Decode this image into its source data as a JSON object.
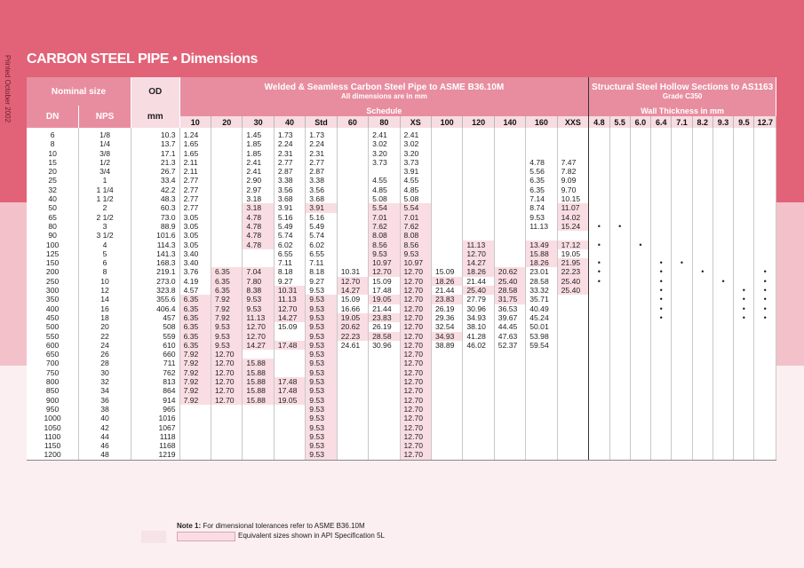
{
  "page": {
    "side_text": "Printed October 2002",
    "title": "CARBON STEEL PIPE • Dimensions"
  },
  "headers": {
    "nominal_size": "Nominal size",
    "od": "OD",
    "welded_title": "Welded & Seamless Carbon Steel Pipe to ASME B36.10M",
    "welded_sub": "All dimensions are in mm",
    "structural_title": "Structural Steel Hollow Sections to AS1163",
    "structural_sub": "Grade C350",
    "dn": "DN",
    "nps": "NPS",
    "mm": "mm",
    "schedule": "Schedule",
    "wall_thickness": "Wall Thickness in mm",
    "schedules": [
      "10",
      "20",
      "30",
      "40",
      "Std",
      "60",
      "80",
      "XS",
      "100",
      "120",
      "140",
      "160",
      "XXS"
    ],
    "wall": [
      "4.8",
      "5.5",
      "6.0",
      "6.4",
      "7.1",
      "8.2",
      "9.3",
      "9.5",
      "12.7"
    ]
  },
  "rows": [
    {
      "dn": "6",
      "nps": "1/8",
      "od": "10.3",
      "s": [
        "1.24",
        "",
        "1.45",
        "1.73",
        "1.73",
        "",
        "2.41",
        "2.41",
        "",
        "",
        "",
        "",
        ""
      ],
      "hl": [],
      "w": []
    },
    {
      "dn": "8",
      "nps": "1/4",
      "od": "13.7",
      "s": [
        "1.65",
        "",
        "1.85",
        "2.24",
        "2.24",
        "",
        "3.02",
        "3.02",
        "",
        "",
        "",
        "",
        ""
      ],
      "hl": [],
      "w": []
    },
    {
      "dn": "10",
      "nps": "3/8",
      "od": "17.1",
      "s": [
        "1.65",
        "",
        "1.85",
        "2.31",
        "2.31",
        "",
        "3.20",
        "3.20",
        "",
        "",
        "",
        "",
        ""
      ],
      "hl": [],
      "w": []
    },
    {
      "dn": "15",
      "nps": "1/2",
      "od": "21.3",
      "s": [
        "2.11",
        "",
        "2.41",
        "2.77",
        "2.77",
        "",
        "3.73",
        "3.73",
        "",
        "",
        "",
        "4.78",
        "7.47"
      ],
      "hl": [],
      "w": []
    },
    {
      "dn": "20",
      "nps": "3/4",
      "od": "26.7",
      "s": [
        "2.11",
        "",
        "2.41",
        "2.87",
        "2.87",
        "",
        "",
        "3.91",
        "",
        "",
        "",
        "5.56",
        "7.82"
      ],
      "hl": [],
      "w": []
    },
    {
      "dn": "25",
      "nps": "1",
      "od": "33.4",
      "s": [
        "2.77",
        "",
        "2.90",
        "3.38",
        "3.38",
        "",
        "4.55",
        "4.55",
        "",
        "",
        "",
        "6.35",
        "9.09"
      ],
      "hl": [],
      "w": []
    },
    {
      "dn": "32",
      "nps": "1 1/4",
      "od": "42.2",
      "s": [
        "2.77",
        "",
        "2.97",
        "3.56",
        "3.56",
        "",
        "4.85",
        "4.85",
        "",
        "",
        "",
        "6.35",
        "9.70"
      ],
      "hl": [],
      "w": []
    },
    {
      "dn": "40",
      "nps": "1 1/2",
      "od": "48.3",
      "s": [
        "2.77",
        "",
        "3.18",
        "3.68",
        "3.68",
        "",
        "5.08",
        "5.08",
        "",
        "",
        "",
        "7.14",
        "10.15"
      ],
      "hl": [],
      "w": []
    },
    {
      "dn": "50",
      "nps": "2",
      "od": "60.3",
      "s": [
        "2.77",
        "",
        "3.18",
        "3.91",
        "3.91",
        "",
        "5.54",
        "5.54",
        "",
        "",
        "",
        "8.74",
        "11.07"
      ],
      "hl": [
        2,
        4,
        6,
        7,
        12
      ],
      "w": []
    },
    {
      "dn": "65",
      "nps": "2 1/2",
      "od": "73.0",
      "s": [
        "3.05",
        "",
        "4.78",
        "5.16",
        "5.16",
        "",
        "7.01",
        "7.01",
        "",
        "",
        "",
        "9.53",
        "14.02"
      ],
      "hl": [
        2,
        6,
        7,
        12
      ],
      "w": []
    },
    {
      "dn": "80",
      "nps": "3",
      "od": "88.9",
      "s": [
        "3.05",
        "",
        "4.78",
        "5.49",
        "5.49",
        "",
        "7.62",
        "7.62",
        "",
        "",
        "",
        "11.13",
        "15.24"
      ],
      "hl": [
        2,
        6,
        7,
        12
      ],
      "w": [
        0,
        1
      ]
    },
    {
      "dn": "90",
      "nps": "3 1/2",
      "od": "101.6",
      "s": [
        "3.05",
        "",
        "4.78",
        "5.74",
        "5.74",
        "",
        "8.08",
        "8.08",
        "",
        "",
        "",
        "",
        ""
      ],
      "hl": [
        2,
        6,
        7
      ],
      "w": []
    },
    {
      "dn": "100",
      "nps": "4",
      "od": "114.3",
      "s": [
        "3.05",
        "",
        "4.78",
        "6.02",
        "6.02",
        "",
        "8.56",
        "8.56",
        "",
        "11.13",
        "",
        "13.49",
        "17.12"
      ],
      "hl": [
        2,
        6,
        7,
        9,
        11,
        12
      ],
      "w": [
        0,
        2
      ]
    },
    {
      "dn": "125",
      "nps": "5",
      "od": "141.3",
      "s": [
        "3.40",
        "",
        "",
        "6.55",
        "6.55",
        "",
        "9.53",
        "9.53",
        "",
        "12.70",
        "",
        "15.88",
        "19.05"
      ],
      "hl": [
        6,
        7,
        9,
        11
      ],
      "w": []
    },
    {
      "dn": "150",
      "nps": "6",
      "od": "168.3",
      "s": [
        "3.40",
        "",
        "",
        "7.11",
        "7.11",
        "",
        "10.97",
        "10.97",
        "",
        "14.27",
        "",
        "18.26",
        "21.95"
      ],
      "hl": [
        6,
        7,
        9,
        11,
        12
      ],
      "w": [
        0,
        3,
        4
      ]
    },
    {
      "dn": "200",
      "nps": "8",
      "od": "219.1",
      "s": [
        "3.76",
        "6.35",
        "7.04",
        "8.18",
        "8.18",
        "10.31",
        "12.70",
        "12.70",
        "15.09",
        "18.26",
        "20.62",
        "23.01",
        "22.23"
      ],
      "hl": [
        1,
        2,
        6,
        7,
        9,
        10,
        12
      ],
      "w": [
        0,
        3,
        5,
        8
      ]
    },
    {
      "dn": "250",
      "nps": "10",
      "od": "273.0",
      "s": [
        "4.19",
        "6.35",
        "7.80",
        "9.27",
        "9.27",
        "12.70",
        "15.09",
        "12.70",
        "18.26",
        "21.44",
        "25.40",
        "28.58",
        "25.40"
      ],
      "hl": [
        1,
        2,
        5,
        7,
        8,
        10,
        12
      ],
      "w": [
        0,
        3,
        6,
        8
      ]
    },
    {
      "dn": "300",
      "nps": "12",
      "od": "323.8",
      "s": [
        "4.57",
        "6.35",
        "8.38",
        "10.31",
        "9.53",
        "14.27",
        "17.48",
        "12.70",
        "21.44",
        "25.40",
        "28.58",
        "33.32",
        "25.40"
      ],
      "hl": [
        1,
        2,
        3,
        5,
        7,
        9,
        10,
        12
      ],
      "w": [
        3,
        7,
        8
      ]
    },
    {
      "dn": "350",
      "nps": "14",
      "od": "355.6",
      "s": [
        "6.35",
        "7.92",
        "9.53",
        "11.13",
        "9.53",
        "15.09",
        "19.05",
        "12.70",
        "23.83",
        "27.79",
        "31.75",
        "35.71",
        ""
      ],
      "hl": [
        0,
        1,
        2,
        3,
        4,
        6,
        7,
        8,
        10
      ],
      "w": [
        3,
        7,
        8
      ]
    },
    {
      "dn": "400",
      "nps": "16",
      "od": "406.4",
      "s": [
        "6.35",
        "7.92",
        "9.53",
        "12.70",
        "9.53",
        "16.66",
        "21.44",
        "12.70",
        "26.19",
        "30.96",
        "36.53",
        "40.49",
        ""
      ],
      "hl": [
        0,
        1,
        2,
        3,
        4,
        7
      ],
      "w": [
        3,
        7,
        8
      ]
    },
    {
      "dn": "450",
      "nps": "18",
      "od": "457",
      "s": [
        "6.35",
        "7.92",
        "11.13",
        "14.27",
        "9.53",
        "19.05",
        "23.83",
        "12.70",
        "29.36",
        "34.93",
        "39.67",
        "45.24",
        ""
      ],
      "hl": [
        0,
        1,
        2,
        3,
        4,
        5,
        6,
        7
      ],
      "w": [
        3,
        7,
        8
      ]
    },
    {
      "dn": "500",
      "nps": "20",
      "od": "508",
      "s": [
        "6.35",
        "9.53",
        "12.70",
        "15.09",
        "9.53",
        "20.62",
        "26.19",
        "12.70",
        "32.54",
        "38.10",
        "44.45",
        "50.01",
        ""
      ],
      "hl": [
        0,
        1,
        2,
        4,
        5,
        7
      ],
      "w": []
    },
    {
      "dn": "550",
      "nps": "22",
      "od": "559",
      "s": [
        "6.35",
        "9.53",
        "12.70",
        "",
        "9.53",
        "22.23",
        "28.58",
        "12.70",
        "34.93",
        "41.28",
        "47.63",
        "53.98",
        ""
      ],
      "hl": [
        0,
        1,
        2,
        4,
        5,
        6,
        7,
        8
      ],
      "w": []
    },
    {
      "dn": "600",
      "nps": "24",
      "od": "610",
      "s": [
        "6.35",
        "9.53",
        "14.27",
        "17.48",
        "9.53",
        "24.61",
        "30.96",
        "12.70",
        "38.89",
        "46.02",
        "52.37",
        "59.54",
        ""
      ],
      "hl": [
        0,
        1,
        2,
        3,
        4,
        7
      ],
      "w": []
    },
    {
      "dn": "650",
      "nps": "26",
      "od": "660",
      "s": [
        "7.92",
        "12.70",
        "",
        "",
        "9.53",
        "",
        "",
        "12.70",
        "",
        "",
        "",
        "",
        ""
      ],
      "hl": [
        0,
        1,
        4,
        7
      ],
      "w": []
    },
    {
      "dn": "700",
      "nps": "28",
      "od": "711",
      "s": [
        "7.92",
        "12.70",
        "15.88",
        "",
        "9.53",
        "",
        "",
        "12.70",
        "",
        "",
        "",
        "",
        ""
      ],
      "hl": [
        0,
        1,
        2,
        4,
        7
      ],
      "w": []
    },
    {
      "dn": "750",
      "nps": "30",
      "od": "762",
      "s": [
        "7.92",
        "12.70",
        "15.88",
        "",
        "9.53",
        "",
        "",
        "12.70",
        "",
        "",
        "",
        "",
        ""
      ],
      "hl": [
        0,
        1,
        2,
        4,
        7
      ],
      "w": []
    },
    {
      "dn": "800",
      "nps": "32",
      "od": "813",
      "s": [
        "7.92",
        "12.70",
        "15.88",
        "17.48",
        "9.53",
        "",
        "",
        "12.70",
        "",
        "",
        "",
        "",
        ""
      ],
      "hl": [
        0,
        1,
        2,
        3,
        4,
        7
      ],
      "w": []
    },
    {
      "dn": "850",
      "nps": "34",
      "od": "864",
      "s": [
        "7.92",
        "12.70",
        "15.88",
        "17.48",
        "9.53",
        "",
        "",
        "12.70",
        "",
        "",
        "",
        "",
        ""
      ],
      "hl": [
        0,
        1,
        2,
        3,
        4,
        7
      ],
      "w": []
    },
    {
      "dn": "900",
      "nps": "36",
      "od": "914",
      "s": [
        "7.92",
        "12.70",
        "15.88",
        "19.05",
        "9.53",
        "",
        "",
        "12.70",
        "",
        "",
        "",
        "",
        ""
      ],
      "hl": [
        0,
        1,
        2,
        3,
        4,
        7
      ],
      "w": []
    },
    {
      "dn": "950",
      "nps": "38",
      "od": "965",
      "s": [
        "",
        "",
        "",
        "",
        "9.53",
        "",
        "",
        "12.70",
        "",
        "",
        "",
        "",
        ""
      ],
      "hl": [
        4,
        7
      ],
      "w": []
    },
    {
      "dn": "1000",
      "nps": "40",
      "od": "1016",
      "s": [
        "",
        "",
        "",
        "",
        "9.53",
        "",
        "",
        "12.70",
        "",
        "",
        "",
        "",
        ""
      ],
      "hl": [
        4,
        7
      ],
      "w": []
    },
    {
      "dn": "1050",
      "nps": "42",
      "od": "1067",
      "s": [
        "",
        "",
        "",
        "",
        "9.53",
        "",
        "",
        "12.70",
        "",
        "",
        "",
        "",
        ""
      ],
      "hl": [
        4,
        7
      ],
      "w": []
    },
    {
      "dn": "1100",
      "nps": "44",
      "od": "1118",
      "s": [
        "",
        "",
        "",
        "",
        "9.53",
        "",
        "",
        "12.70",
        "",
        "",
        "",
        "",
        ""
      ],
      "hl": [
        4,
        7
      ],
      "w": []
    },
    {
      "dn": "1150",
      "nps": "46",
      "od": "1168",
      "s": [
        "",
        "",
        "",
        "",
        "9.53",
        "",
        "",
        "12.70",
        "",
        "",
        "",
        "",
        ""
      ],
      "hl": [
        4,
        7
      ],
      "w": []
    },
    {
      "dn": "1200",
      "nps": "48",
      "od": "1219",
      "s": [
        "",
        "",
        "",
        "",
        "9.53",
        "",
        "",
        "12.70",
        "",
        "",
        "",
        "",
        ""
      ],
      "hl": [
        4,
        7
      ],
      "w": []
    }
  ],
  "wall_mark": "•",
  "notes": {
    "note_label": "Note 1:",
    "note_text": " For dimensional tolerances refer to ASME B36.10M",
    "legend_text": "Equivalent sizes shown in API Specification 5L"
  },
  "colors": {
    "top_band": "#e26277",
    "mid_band": "#f3c1c9",
    "header_pink": "#e88da0",
    "highlight": "#f9dde3"
  }
}
